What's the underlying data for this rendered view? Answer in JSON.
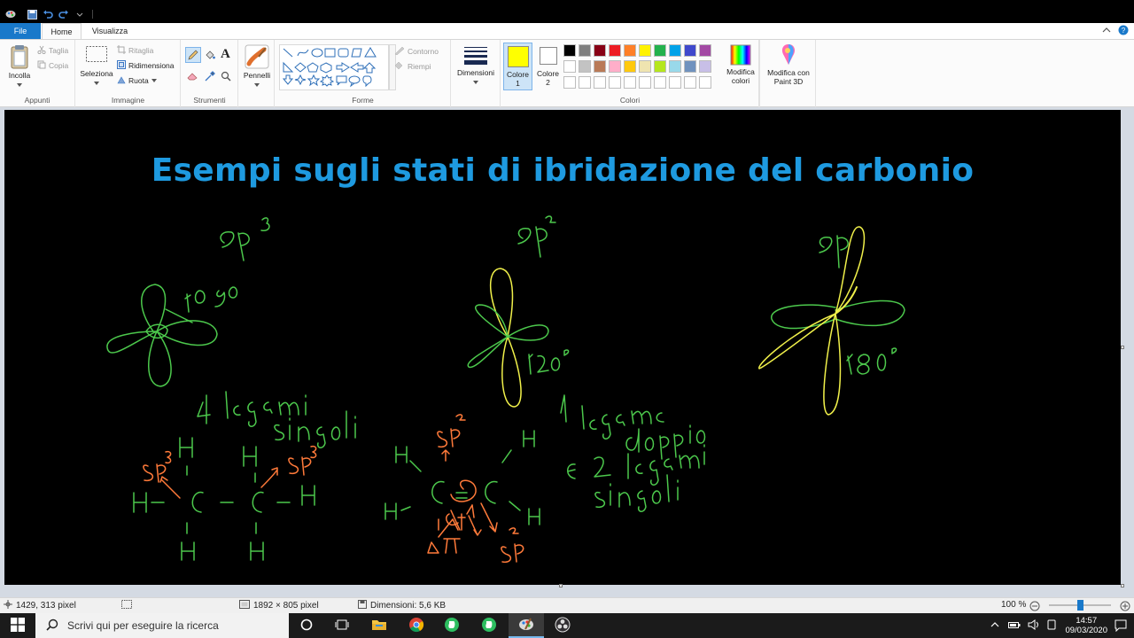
{
  "tabs": {
    "file": "File",
    "home": "Home",
    "view": "Visualizza"
  },
  "ribbon": {
    "clipboard": {
      "paste": "Incolla",
      "cut": "Taglia",
      "copy": "Copia",
      "label": "Appunti"
    },
    "image": {
      "select": "Seleziona",
      "crop": "Ritaglia",
      "resize": "Ridimensiona",
      "rotate": "Ruota",
      "label": "Immagine"
    },
    "tools": {
      "label": "Strumenti"
    },
    "brushes": {
      "label": "Pennelli"
    },
    "shapes": {
      "outline": "Contorno",
      "fill": "Riempi",
      "label": "Forme"
    },
    "size": {
      "label": "Dimensioni"
    },
    "color1": {
      "label": "Colore",
      "sub": "1",
      "value": "#ffff00"
    },
    "color2": {
      "label": "Colore",
      "sub": "2",
      "value": "#ffffff"
    },
    "colors": {
      "label": "Colori",
      "row1": [
        "#000000",
        "#7f7f7f",
        "#880015",
        "#ed1c24",
        "#ff7f27",
        "#fff200",
        "#22b14c",
        "#00a2e8",
        "#3f48cc",
        "#a349a4"
      ],
      "row2": [
        "#ffffff",
        "#c3c3c3",
        "#b97a57",
        "#ffaec9",
        "#ffc90e",
        "#efe4b0",
        "#b5e61d",
        "#99d9ea",
        "#7092be",
        "#c8bfe7"
      ],
      "row3": [
        "#ffffff",
        "#ffffff",
        "#ffffff",
        "#ffffff",
        "#ffffff",
        "#ffffff",
        "#ffffff",
        "#ffffff",
        "#ffffff",
        "#ffffff"
      ]
    },
    "edit_colors": {
      "line1": "Modifica",
      "line2": "colori"
    },
    "paint3d": {
      "line1": "Modifica con",
      "line2": "Paint 3D"
    }
  },
  "canvas": {
    "title": "Esempi sugli stati di ibridazione del carbonio",
    "accent_title": "#1e9ae0",
    "green": "#4cc84c",
    "yellow": "#f0f04a",
    "orange": "#ff7a3a"
  },
  "status": {
    "cursor": "1429, 313 pixel",
    "image_size": "1892 × 805 pixel",
    "file_size": "Dimensioni: 5,6 KB",
    "zoom": "100 %"
  },
  "taskbar": {
    "search_placeholder": "Scrivi qui per eseguire la ricerca",
    "time": "14:57",
    "date": "09/03/2020"
  }
}
